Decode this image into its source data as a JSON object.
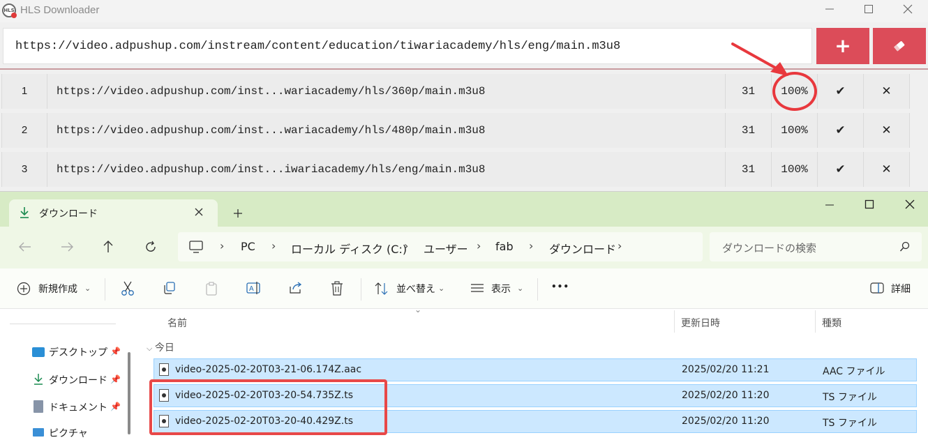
{
  "hls": {
    "title": "HLS Downloader",
    "logo_text": "HLS",
    "url_value": "https://video.adpushup.com/instream/content/education/tiwariacademy/hls/eng/main.m3u8",
    "add_label": "+",
    "clear_icon": "eraser-icon",
    "rows": [
      {
        "index": "1",
        "url": "https://video.adpushup.com/inst...wariacademy/hls/360p/main.m3u8",
        "count": "31",
        "progress": "100%",
        "done": "✔",
        "remove": "✕"
      },
      {
        "index": "2",
        "url": "https://video.adpushup.com/inst...wariacademy/hls/480p/main.m3u8",
        "count": "31",
        "progress": "100%",
        "done": "✔",
        "remove": "✕"
      },
      {
        "index": "3",
        "url": "https://video.adpushup.com/inst...iwariacademy/hls/eng/main.m3u8",
        "count": "31",
        "progress": "100%",
        "done": "✔",
        "remove": "✕"
      }
    ]
  },
  "explorer": {
    "tab_label": "ダウンロード",
    "breadcrumbs": [
      "PC",
      "ローカル ディスク (C:)",
      "ユーザー",
      "fab",
      "ダウンロード"
    ],
    "search_placeholder": "ダウンロードの検索",
    "toolbar": {
      "new": "新規作成",
      "sort": "並べ替え",
      "view": "表示",
      "more": "•••",
      "details": "詳細"
    },
    "nav_items": [
      "デスクトップ",
      "ダウンロード",
      "ドキュメント",
      "ピクチャ"
    ],
    "columns": {
      "name": "名前",
      "date": "更新日時",
      "type": "種類"
    },
    "group": "今日",
    "files": [
      {
        "name": "video-2025-02-20T03-21-06.174Z.aac",
        "date": "2025/02/20 11:21",
        "type": "AAC ファイル"
      },
      {
        "name": "video-2025-02-20T03-20-54.735Z.ts",
        "date": "2025/02/20 11:20",
        "type": "TS ファイル"
      },
      {
        "name": "video-2025-02-20T03-20-40.429Z.ts",
        "date": "2025/02/20 11:20",
        "type": "TS ファイル"
      }
    ]
  },
  "colors": {
    "accent_red": "#dc4c59",
    "annotation_red": "#e8383d",
    "explorer_green": "#d7ebc5",
    "selection_blue": "#cce8ff"
  }
}
